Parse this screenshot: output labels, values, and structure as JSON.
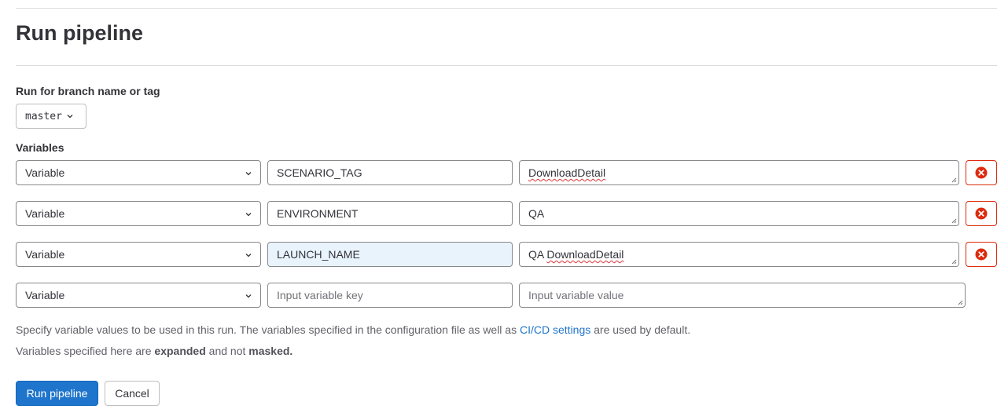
{
  "page": {
    "title": "Run pipeline"
  },
  "branch": {
    "label": "Run for branch name or tag",
    "selected": "master"
  },
  "variables": {
    "label": "Variables",
    "rows": [
      {
        "type": "Variable",
        "key": "SCENARIO_TAG",
        "value": "DownloadDetail",
        "removable": true
      },
      {
        "type": "Variable",
        "key": "ENVIRONMENT",
        "value": "QA",
        "removable": true
      },
      {
        "type": "Variable",
        "key": "LAUNCH_NAME",
        "value_prefix": "QA ",
        "value": "DownloadDetail",
        "removable": true,
        "focused": true
      },
      {
        "type": "Variable",
        "key_placeholder": "Input variable key",
        "value_placeholder": "Input variable value",
        "removable": false
      }
    ]
  },
  "help": {
    "line1_before": "Specify variable values to be used in this run. The variables specified in the configuration file as well as ",
    "line1_link": "CI/CD settings",
    "line1_after": " are used by default.",
    "line2_before": "Variables specified here are ",
    "line2_bold1": "expanded",
    "line2_middle": " and not ",
    "line2_bold2": "masked."
  },
  "actions": {
    "run_label": "Run pipeline",
    "cancel_label": "Cancel"
  },
  "colors": {
    "primary": "#1f75cb",
    "danger": "#dd2b0e",
    "focus_bg": "#e9f3fc",
    "link": "#1f75cb"
  },
  "icons": {
    "dropdown": "chevron-down-icon",
    "remove": "remove-circle-icon",
    "resize": "resize-grip-icon"
  }
}
